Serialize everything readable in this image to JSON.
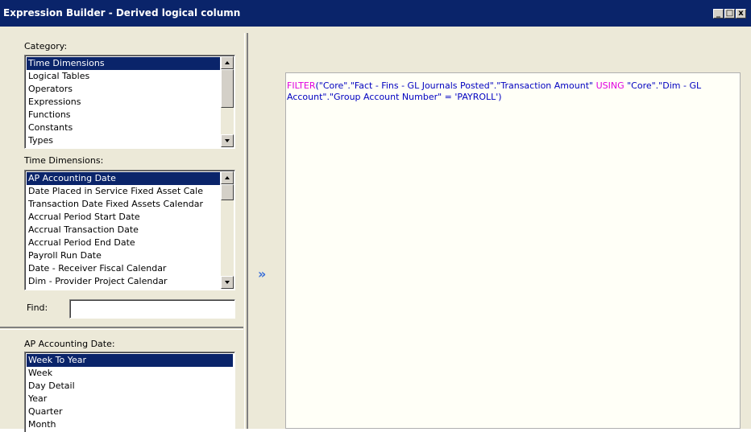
{
  "window": {
    "title": "Expression Builder - Derived logical column",
    "min_glyph": "_",
    "max_glyph": "□",
    "close_glyph": "x"
  },
  "category": {
    "label": "Category:",
    "items": [
      "Time Dimensions",
      "Logical Tables",
      "Operators",
      "Expressions",
      "Functions",
      "Constants",
      "Types"
    ],
    "selected": "Time Dimensions"
  },
  "time_dimensions": {
    "label": "Time Dimensions:",
    "items": [
      "AP Accounting Date",
      "Date Placed in Service Fixed Asset Cale",
      "Transaction Date Fixed Assets Calendar",
      "Accrual Period Start Date",
      "Accrual Transaction Date",
      "Accrual Period End Date",
      "Payroll Run Date",
      "Date - Receiver Fiscal Calendar",
      "Dim - Provider Project Calendar"
    ],
    "selected": "AP Accounting Date"
  },
  "find": {
    "label": "Find:",
    "value": ""
  },
  "insert_button": {
    "glyph": "»",
    "icon": "insert-arrow-icon"
  },
  "ap_accounting_date": {
    "label": "AP Accounting Date:",
    "items": [
      "Week To Year",
      "Week",
      "Day Detail",
      "Year",
      "Quarter",
      "Month"
    ],
    "selected": "Week To Year"
  },
  "expression": {
    "keyword1": "FILTER",
    "part1": "(\"Core\".\"Fact - Fins - GL Journals Posted\".\"Transaction Amount\" ",
    "keyword2": "USING",
    "part2": " \"Core\".\"Dim - GL Account\".\"Group Account Number\" = 'PAYROLL')"
  },
  "colors": {
    "titlebar": "#0a246a",
    "selection": "#0a246a",
    "dialog_bg": "#ece9d8",
    "expr_text": "#0000c0",
    "expr_keyword": "#e000e0"
  }
}
